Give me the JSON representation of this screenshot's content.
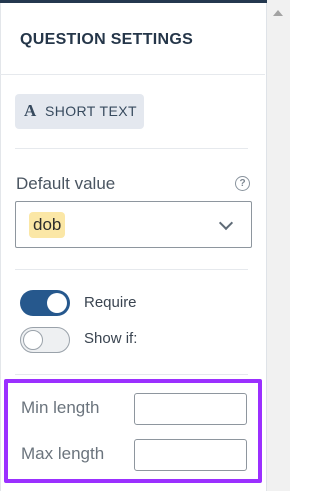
{
  "panel": {
    "title": "QUESTION SETTINGS",
    "question_type": {
      "icon": "text-type-icon",
      "icon_glyph": "A",
      "label": "SHORT TEXT"
    },
    "default_value": {
      "label": "Default value",
      "help_icon": "help-circle-icon",
      "help_glyph": "?",
      "selected_token": "dob",
      "dropdown_icon": "chevron-down-icon"
    },
    "toggles": [
      {
        "label": "Require",
        "on": true
      },
      {
        "label": "Show if:",
        "on": false
      }
    ],
    "length": {
      "min_label": "Min length",
      "min_value": "",
      "max_label": "Max length",
      "max_value": ""
    }
  },
  "colors": {
    "accent": "#26588d",
    "highlight": "#9b30ff",
    "token_bg": "#fbe7a6",
    "chip_bg": "#e4e8ef"
  }
}
